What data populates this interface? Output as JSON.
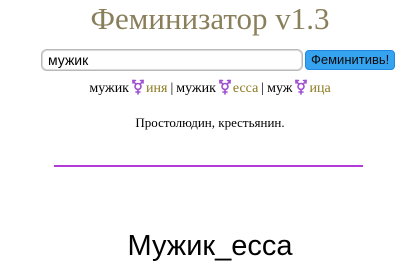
{
  "app": {
    "title": "Феминизатор v1.3"
  },
  "search": {
    "value": "мужик",
    "button_label": "Феминитивь!"
  },
  "variants": [
    {
      "root": "мужик",
      "suffix": "иня"
    },
    {
      "root": "мужик",
      "suffix": "есса"
    },
    {
      "root": "муж",
      "suffix": "ица"
    }
  ],
  "variant_separator": "|",
  "definition": "Простолюдин, крестьянин.",
  "result": "Мужик_есса",
  "colors": {
    "title": "#8a7f5b",
    "suffix": "#8d7a23",
    "gender_icon": "#a04fd0",
    "button": "#36a3f0",
    "divider": "#b23ad7"
  },
  "icons": {
    "gender_icon": "transgender-symbol-icon"
  }
}
